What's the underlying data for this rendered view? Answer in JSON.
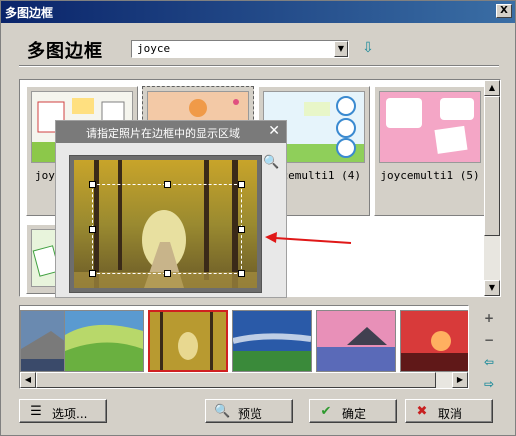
{
  "window": {
    "title": "多图边框",
    "close_glyph": "X"
  },
  "header": {
    "heading": "多图边框",
    "combo_value": "joyce",
    "download_icon": "download-arrow-icon"
  },
  "gallery": {
    "items": [
      {
        "label": "joy"
      },
      {
        "label": ""
      },
      {
        "label": "cemulti1 (4)"
      },
      {
        "label": "joycemulti1 (5)"
      },
      {
        "label": ""
      }
    ]
  },
  "popup": {
    "title": "请指定照片在边框中的显示区域",
    "close_glyph": "✕"
  },
  "side_controls": {
    "add": "+",
    "remove": "−",
    "left": "⇦",
    "right": "⇨"
  },
  "buttons": {
    "options": "选项...",
    "preview": "预览",
    "ok": "确定",
    "cancel": "取消"
  },
  "colors": {
    "titlebar": "#0a246a",
    "ok_check": "#2e9a2e",
    "cancel_x": "#c82020",
    "annotation_arrow": "#e01818"
  }
}
